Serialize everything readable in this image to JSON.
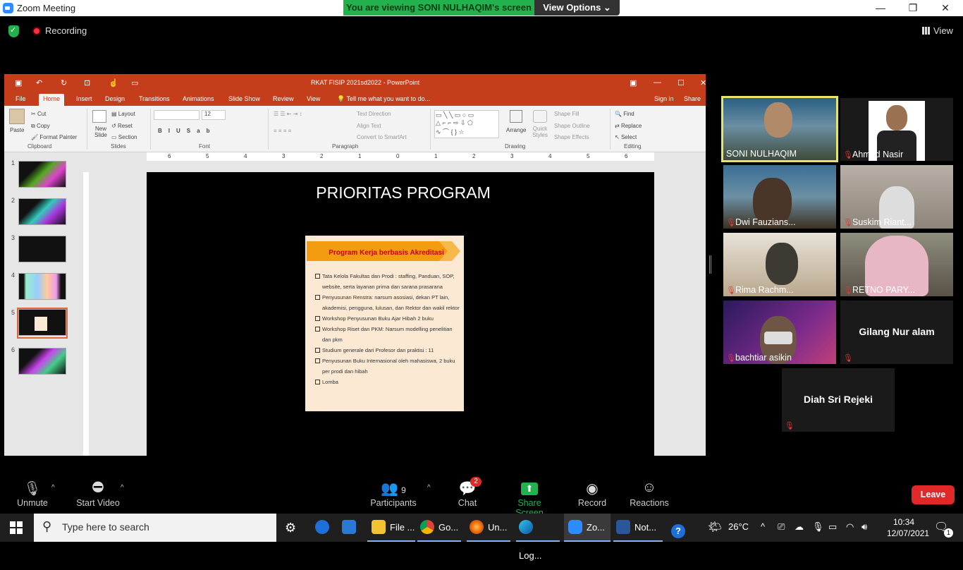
{
  "window": {
    "title": "Zoom Meeting",
    "minimize": "—",
    "restore": "❐",
    "close": "✕"
  },
  "share_banner": {
    "text": "You are viewing SONI NULHAQIM's screen",
    "view_options": "View Options ⌄"
  },
  "meeting": {
    "recording": "Recording",
    "view": "View"
  },
  "ppt": {
    "doc_title": "RKAT FISIP 2021sd2022 - PowerPoint",
    "tabs": [
      "File",
      "Home",
      "Insert",
      "Design",
      "Transitions",
      "Animations",
      "Slide Show",
      "Review",
      "View"
    ],
    "tell_me": "Tell me what you want to do...",
    "sign_in": "Sign in",
    "share": "Share",
    "clipboard": {
      "paste": "Paste",
      "cut": "Cut",
      "copy": "Copy",
      "format_painter": "Format Painter",
      "label": "Clipboard"
    },
    "slides": {
      "new_slide": "New Slide",
      "layout": "Layout",
      "reset": "Reset",
      "section": "Section",
      "label": "Slides"
    },
    "font": {
      "size": "12",
      "label": "Font"
    },
    "paragraph": {
      "text_direction": "Text Direction",
      "align_text": "Align Text",
      "convert": "Convert to SmartArt",
      "label": "Paragraph"
    },
    "drawing": {
      "arrange": "Arrange",
      "quick_styles": "Quick Styles",
      "shape_fill": "Shape Fill",
      "shape_outline": "Shape Outline",
      "shape_effects": "Shape Effects",
      "label": "Drawing"
    },
    "editing": {
      "find": "Find",
      "replace": "Replace",
      "select": "Select",
      "label": "Editing"
    },
    "thumbnail_numbers": [
      "1",
      "2",
      "3",
      "4",
      "5",
      "6"
    ],
    "ruler_numbers": [
      "6",
      "5",
      "4",
      "3",
      "2",
      "1",
      "0",
      "1",
      "2",
      "3",
      "4",
      "5",
      "6"
    ],
    "slide": {
      "title": "PRIORITAS PROGRAM",
      "card_title": "Program Kerja berbasis Akreditasi",
      "items": [
        "Tata Kelola Fakultas dan Prodi : staffing, Panduan, SOP, website, serta layanan prima dan sarana prasarana",
        "Penyusunan Renstra: narsum asosiasi, dekan PT lain, akademisi, pengguna, lulusan, dan Rektor dan wakil rektor",
        "Workshop Penyusunan Buku Ajar Hibah 2 buku",
        "Workshop Riset dan PKM: Narsum modelling penelitian dan pkm",
        "Studium generale dari Profesor dan praktisi : 11",
        "Penyusunan Buku Internasional oleh mahasiswa, 2 buku per prodi dan hibah",
        "Lomba"
      ]
    }
  },
  "participants": [
    {
      "name": "SONI NULHAQIM"
    },
    {
      "name": "Ahmad Nasir"
    },
    {
      "name": "Dwi Fauzians..."
    },
    {
      "name": "Suskim Riant..."
    },
    {
      "name": "Rima Rachm..."
    },
    {
      "name": "RETNO PARY..."
    },
    {
      "name": "bachtiar asikin"
    },
    {
      "name": "Gilang Nur alam"
    },
    {
      "name": "Diah Sri Rejeki"
    }
  ],
  "toolbar": {
    "unmute": "Unmute",
    "start_video": "Start Video",
    "participants": "Participants",
    "participants_count": "9",
    "chat": "Chat",
    "chat_badge": "2",
    "share_screen": "Share Screen",
    "record": "Record",
    "reactions": "Reactions",
    "leave": "Leave"
  },
  "taskbar": {
    "search_placeholder": "Type here to search",
    "apps": [
      "File ...",
      "Go...",
      "Un...",
      "Log...",
      "Zo...",
      "Not..."
    ],
    "temperature": "26°C",
    "time": "10:34",
    "date": "12/07/2021",
    "notification_count": "1"
  },
  "colors": {
    "ppt_accent": "#c43e1c",
    "zoom_green": "#22b14c",
    "leave_red": "#e02828",
    "active_speaker": "#e5e566"
  }
}
